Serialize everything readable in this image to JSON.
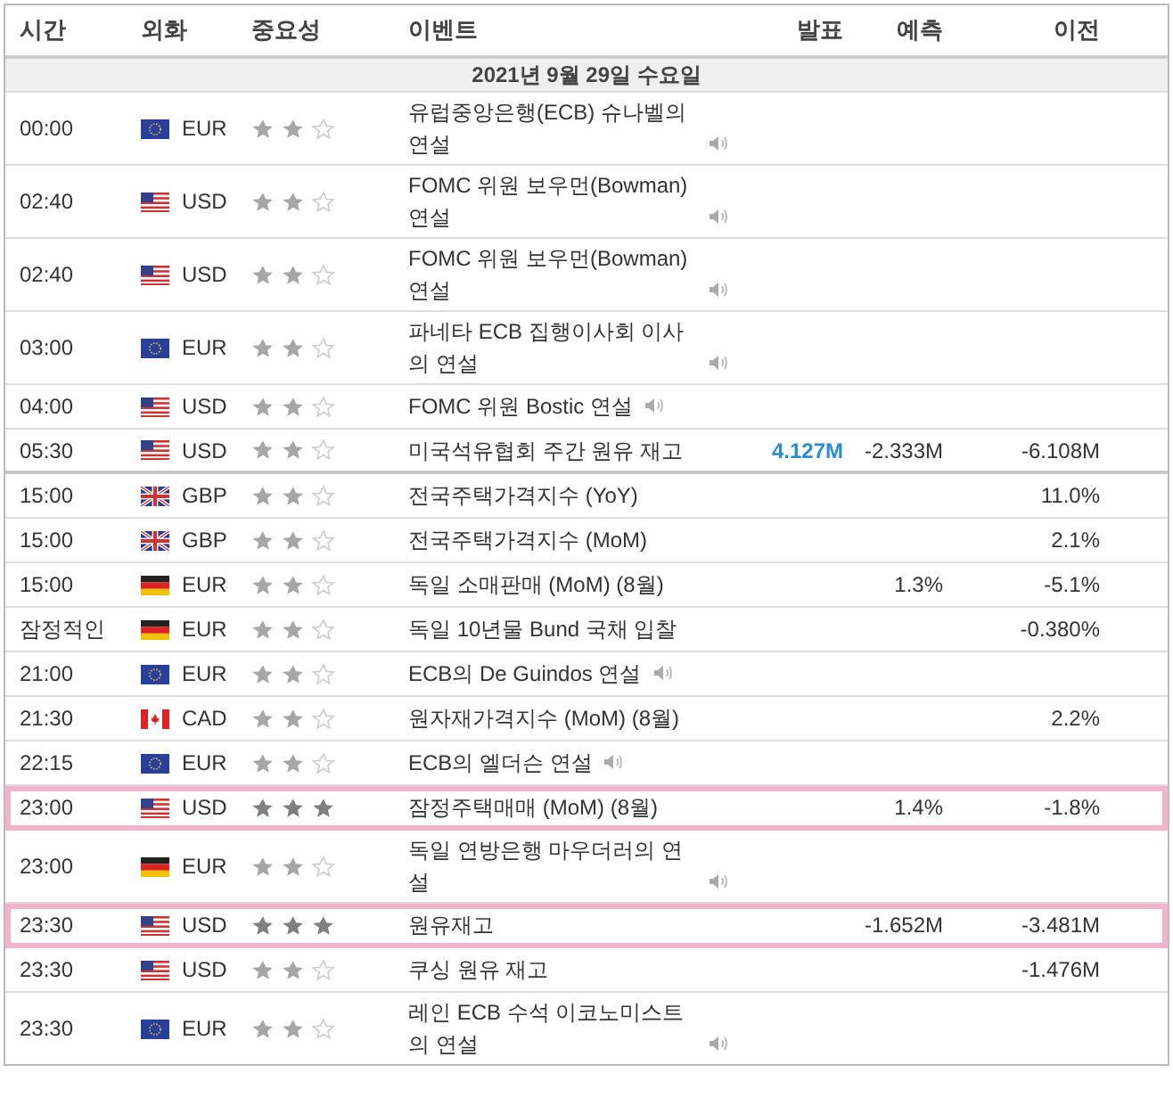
{
  "columns": [
    {
      "label": "시간"
    },
    {
      "label": "외화"
    },
    {
      "label": "중요성"
    },
    {
      "label": "이벤트"
    },
    {
      "label": "발표"
    },
    {
      "label": "예측"
    },
    {
      "label": "이전"
    }
  ],
  "date": "2021년 9월 29일 수요일",
  "sessions": [
    {
      "rows": [
        {
          "time": "00:00",
          "flag": {
            "kind": "eu"
          },
          "currency": "EUR",
          "stars": 2,
          "event": "유럽중앙은행(ECB) 슈나벨의 연설",
          "audio": true,
          "highlighted": false
        },
        {
          "time": "02:40",
          "flag": {
            "kind": "us"
          },
          "currency": "USD",
          "stars": 2,
          "event": "FOMC 위원 보우먼(Bowman) 연설",
          "audio": true,
          "highlighted": false
        },
        {
          "time": "02:40",
          "flag": {
            "kind": "us"
          },
          "currency": "USD",
          "stars": 2,
          "event": "FOMC 위원 보우먼(Bowman) 연설",
          "audio": true,
          "highlighted": false
        },
        {
          "time": "03:00",
          "flag": {
            "kind": "eu"
          },
          "currency": "EUR",
          "stars": 2,
          "event": "파네타 ECB 집행이사회 이사의 연설",
          "audio": true,
          "highlighted": false
        },
        {
          "time": "04:00",
          "flag": {
            "kind": "us"
          },
          "currency": "USD",
          "stars": 2,
          "event": "FOMC 위원 Bostic 연설",
          "audio": true,
          "highlighted": false
        },
        {
          "time": "05:30",
          "flag": {
            "kind": "us"
          },
          "currency": "USD",
          "stars": 2,
          "event": "미국석유협회 주간 원유 재고",
          "audio": false,
          "highlighted": false,
          "actual": "4.127M",
          "forecast": "-2.333M",
          "previous": "-6.108M"
        }
      ]
    },
    {
      "rows": [
        {
          "time": "15:00",
          "flag": {
            "kind": "gb"
          },
          "currency": "GBP",
          "stars": 2,
          "event": "전국주택가격지수 (YoY)",
          "audio": false,
          "highlighted": false,
          "previous": "11.0%"
        },
        {
          "time": "15:00",
          "flag": {
            "kind": "gb"
          },
          "currency": "GBP",
          "stars": 2,
          "event": "전국주택가격지수 (MoM)",
          "audio": false,
          "highlighted": false,
          "previous": "2.1%"
        },
        {
          "time": "15:00",
          "flag": {
            "kind": "de"
          },
          "currency": "EUR",
          "stars": 2,
          "event": "독일 소매판매 (MoM) (8월)",
          "audio": false,
          "highlighted": false,
          "forecast": "1.3%",
          "previous": "-5.1%"
        },
        {
          "time": "잠정적인",
          "flag": {
            "kind": "de"
          },
          "currency": "EUR",
          "stars": 2,
          "event": "독일 10년물 Bund 국채 입찰",
          "audio": false,
          "highlighted": false,
          "previous": "-0.380%"
        },
        {
          "time": "21:00",
          "flag": {
            "kind": "eu"
          },
          "currency": "EUR",
          "stars": 2,
          "event": "ECB의 De Guindos 연설",
          "audio": true,
          "highlighted": false
        },
        {
          "time": "21:30",
          "flag": {
            "kind": "ca"
          },
          "currency": "CAD",
          "stars": 2,
          "event": "원자재가격지수 (MoM) (8월)",
          "audio": false,
          "highlighted": false,
          "previous": "2.2%"
        },
        {
          "time": "22:15",
          "flag": {
            "kind": "eu"
          },
          "currency": "EUR",
          "stars": 2,
          "event": "ECB의 엘더슨 연설",
          "audio": true,
          "highlighted": false
        },
        {
          "time": "23:00",
          "flag": {
            "kind": "us"
          },
          "currency": "USD",
          "stars": 3,
          "event": "잠정주택매매 (MoM) (8월)",
          "audio": false,
          "highlighted": true,
          "forecast": "1.4%",
          "previous": "-1.8%"
        },
        {
          "time": "23:00",
          "flag": {
            "kind": "de"
          },
          "currency": "EUR",
          "stars": 2,
          "event": "독일 연방은행 마우더러의 연설",
          "audio": true,
          "highlighted": false
        },
        {
          "time": "23:30",
          "flag": {
            "kind": "us"
          },
          "currency": "USD",
          "stars": 3,
          "event": "원유재고",
          "audio": false,
          "highlighted": true,
          "forecast": "-1.652M",
          "previous": "-3.481M"
        },
        {
          "time": "23:30",
          "flag": {
            "kind": "us"
          },
          "currency": "USD",
          "stars": 2,
          "event": "쿠싱 원유 재고",
          "audio": false,
          "highlighted": false,
          "previous": "-1.476M"
        },
        {
          "time": "23:30",
          "flag": {
            "kind": "eu"
          },
          "currency": "EUR",
          "stars": 2,
          "event": "레인 ECB 수석 이코노미스트의 연설",
          "audio": true,
          "highlighted": false
        }
      ]
    }
  ]
}
